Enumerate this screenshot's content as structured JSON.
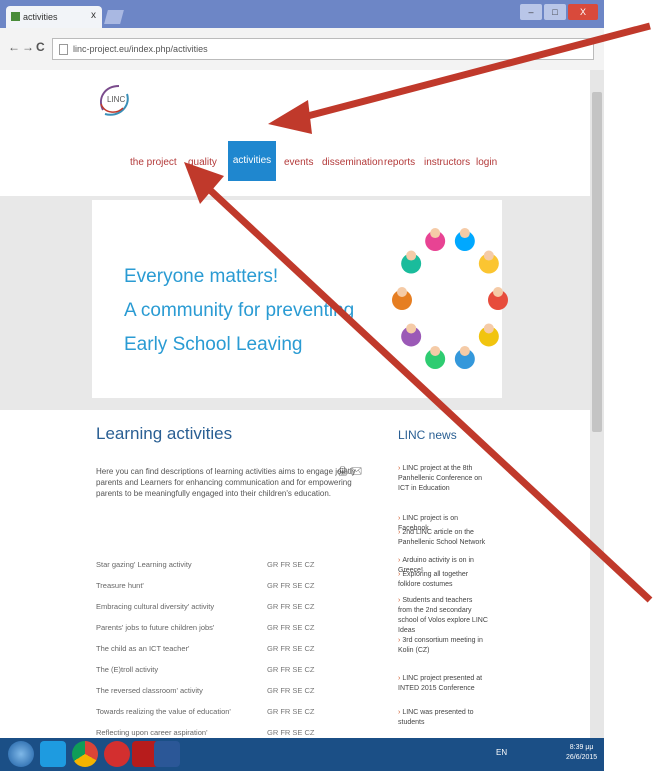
{
  "browser": {
    "tab_title": "activities",
    "tab_close": "x",
    "url": "linc-project.eu/index.php/activities",
    "back": "←",
    "forward": "→",
    "reload": "C",
    "window_minimize": "–",
    "window_maximize": "□",
    "window_close": "X"
  },
  "site": {
    "logo_text": "LINC",
    "nav": [
      {
        "label": "the project"
      },
      {
        "label": "quality"
      },
      {
        "label": "activities"
      },
      {
        "label": "events"
      },
      {
        "label": "dissemination"
      },
      {
        "label": "reports"
      },
      {
        "label": "instructors"
      },
      {
        "label": "login"
      }
    ],
    "hero_lines": [
      "Everyone matters!",
      "A community for preventing",
      "Early School Leaving"
    ],
    "section_title": "Learning activities",
    "intro": "Here you can find descriptions of learning activities aims to engage jointly parents and Learners for enhancing communication and for empowering parents to be meaningfully engaged into their children's education.",
    "activities": [
      {
        "name": "Star gazing' Learning activity",
        "langs": "GR FR SE CZ"
      },
      {
        "name": "Treasure hunt'",
        "langs": "GR FR SE CZ"
      },
      {
        "name": "Embracing cultural diversity' activity",
        "langs": "GR FR SE CZ"
      },
      {
        "name": "Parents' jobs to future children jobs'",
        "langs": "GR FR SE CZ"
      },
      {
        "name": "The child as an ICT teacher'",
        "langs": "GR FR SE CZ"
      },
      {
        "name": "The (E)troll activity",
        "langs": "GR FR SE CZ"
      },
      {
        "name": "The reversed classroom' activity",
        "langs": "GR FR SE CZ"
      },
      {
        "name": "Towards realizing the value of education'",
        "langs": "GR FR SE CZ"
      },
      {
        "name": "Reflecting upon career aspiration'",
        "langs": "GR FR SE CZ"
      }
    ],
    "news_title": "LINC news",
    "news": [
      "LINC project at the 8th Panhellenic Conference on ICT in Education",
      "LINC project is on Facebook",
      "2nd LINC article on the Panhellenic School Network",
      "Arduino activity is on in Greece!",
      "Exploring all together folklore costumes",
      "Students and teachers from the 2nd secondary school of Volos explore LINC Ideas",
      "3rd consortium meeting in Kolin (CZ)",
      "LINC project presented at INTED 2015 Conference",
      "LINC was presented to students"
    ]
  },
  "taskbar": {
    "language": "EN",
    "time": "8:39 μμ",
    "date": "26/6/2015",
    "apps": [
      "windows-start",
      "skype",
      "chrome",
      "opera",
      "acrobat",
      "word"
    ]
  },
  "annotation": {
    "arrow_color": "#c0392b"
  }
}
